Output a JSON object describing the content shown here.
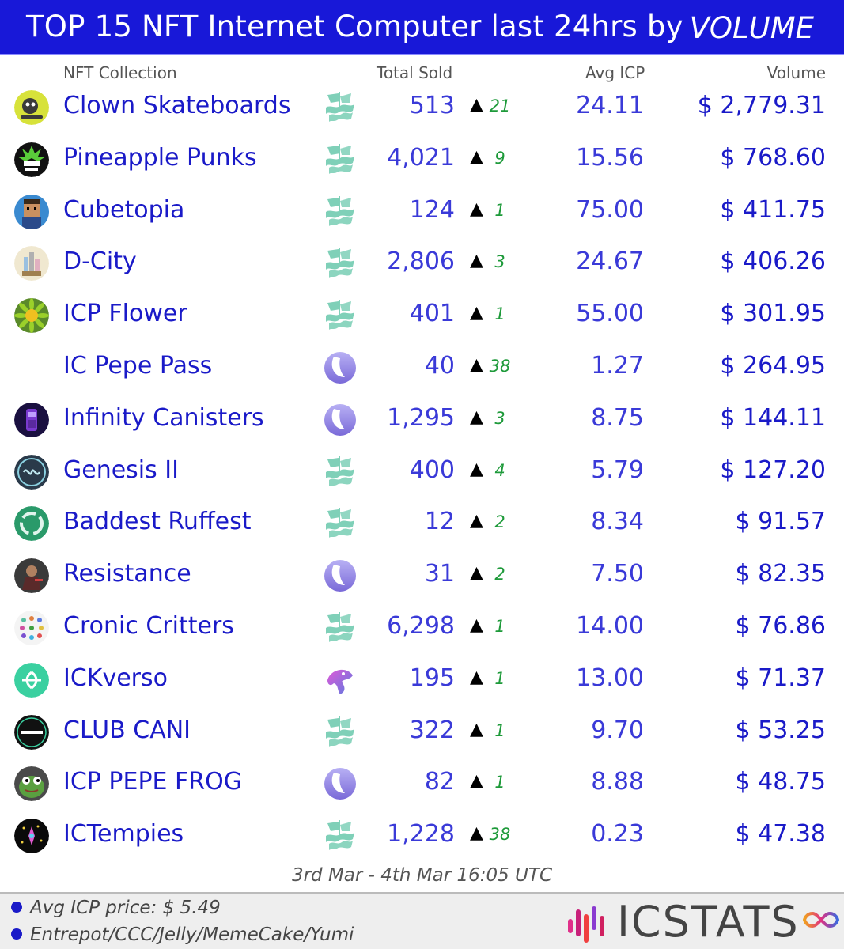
{
  "header": {
    "title": "TOP 15 NFT Internet Computer last 24hrs by",
    "metric": "VOLUME"
  },
  "columns": {
    "collection": "NFT Collection",
    "sold": "Total Sold",
    "avg": "Avg ICP",
    "volume": "Volume"
  },
  "colors": {
    "header_bg": "#1818d8",
    "link_blue": "#1a1ac8",
    "delta_green": "#1e9a3a",
    "entrepot_teal": "#7fd0b8",
    "yumi_purple": "#8b7fe0"
  },
  "rows": [
    {
      "name": "Clown Skateboards",
      "market_icon": "entrepot-ship-icon",
      "avatar_icon": "clown-skateboard-avatar",
      "sold": "513",
      "delta": "21",
      "avg": "24.11",
      "volume": "$ 2,779.31"
    },
    {
      "name": "Pineapple Punks",
      "market_icon": "entrepot-ship-icon",
      "avatar_icon": "pineapple-punk-avatar",
      "sold": "4,021",
      "delta": "9",
      "avg": "15.56",
      "volume": "$ 768.60"
    },
    {
      "name": "Cubetopia",
      "market_icon": "entrepot-ship-icon",
      "avatar_icon": "cubetopia-avatar",
      "sold": "124",
      "delta": "1",
      "avg": "75.00",
      "volume": "$ 411.75"
    },
    {
      "name": "D-City",
      "market_icon": "entrepot-ship-icon",
      "avatar_icon": "dcity-avatar",
      "sold": "2,806",
      "delta": "3",
      "avg": "24.67",
      "volume": "$ 406.26"
    },
    {
      "name": "ICP Flower",
      "market_icon": "entrepot-ship-icon",
      "avatar_icon": "flower-avatar",
      "sold": "401",
      "delta": "1",
      "avg": "55.00",
      "volume": "$ 301.95"
    },
    {
      "name": "IC Pepe Pass",
      "market_icon": "yumi-moon-icon",
      "avatar_icon": "",
      "sold": "40",
      "delta": "38",
      "avg": "1.27",
      "volume": "$ 264.95"
    },
    {
      "name": "Infinity Canisters",
      "market_icon": "yumi-moon-icon",
      "avatar_icon": "infinity-canister-avatar",
      "sold": "1,295",
      "delta": "3",
      "avg": "8.75",
      "volume": "$ 144.11"
    },
    {
      "name": "Genesis II",
      "market_icon": "entrepot-ship-icon",
      "avatar_icon": "genesis-avatar",
      "sold": "400",
      "delta": "4",
      "avg": "5.79",
      "volume": "$ 127.20"
    },
    {
      "name": "Baddest Ruffest",
      "market_icon": "entrepot-ship-icon",
      "avatar_icon": "baddest-ruffest-avatar",
      "sold": "12",
      "delta": "2",
      "avg": "8.34",
      "volume": "$ 91.57"
    },
    {
      "name": "Resistance",
      "market_icon": "yumi-moon-icon",
      "avatar_icon": "resistance-avatar",
      "sold": "31",
      "delta": "2",
      "avg": "7.50",
      "volume": "$ 82.35"
    },
    {
      "name": "Cronic Critters",
      "market_icon": "entrepot-ship-icon",
      "avatar_icon": "cronic-critters-avatar",
      "sold": "6,298",
      "delta": "1",
      "avg": "14.00",
      "volume": "$ 76.86"
    },
    {
      "name": "ICKverso",
      "market_icon": "jelly-fish-icon",
      "avatar_icon": "ickverso-avatar",
      "sold": "195",
      "delta": "1",
      "avg": "13.00",
      "volume": "$ 71.37"
    },
    {
      "name": "CLUB CANI",
      "market_icon": "entrepot-ship-icon",
      "avatar_icon": "canistore-avatar",
      "sold": "322",
      "delta": "1",
      "avg": "9.70",
      "volume": "$ 53.25"
    },
    {
      "name": "ICP PEPE FROG",
      "market_icon": "yumi-moon-icon",
      "avatar_icon": "pepe-frog-avatar",
      "sold": "82",
      "delta": "1",
      "avg": "8.88",
      "volume": "$ 48.75"
    },
    {
      "name": "ICTempies",
      "market_icon": "entrepot-ship-icon",
      "avatar_icon": "ictempies-avatar",
      "sold": "1,228",
      "delta": "38",
      "avg": "0.23",
      "volume": "$ 47.38"
    }
  ],
  "arrow_glyph": "▲",
  "date_range": "3rd Mar - 4th Mar 16:05 UTC",
  "footer": {
    "price_line": "Avg ICP price: $ 5.49",
    "sources_line": "Entrepot/CCC/Jelly/MemeCake/Yumi",
    "brand": "ICSTATS"
  }
}
